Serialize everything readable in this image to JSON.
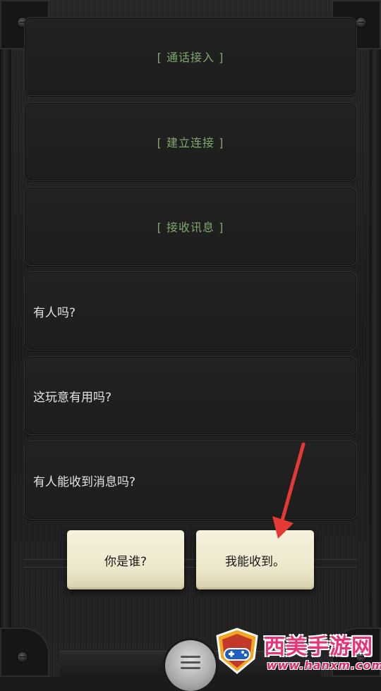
{
  "system_messages": [
    "[ 通话接入 ]",
    "[ 建立连接 ]",
    "[ 接收讯息 ]"
  ],
  "chat_messages": [
    "有人吗?",
    "这玩意有用吗?",
    "有人能收到消息吗?"
  ],
  "choices": {
    "option_a": "你是谁?",
    "option_b": "我能收到。"
  },
  "watermark": {
    "title": "西美手游网",
    "url": "www.hanxm.com"
  },
  "colors": {
    "system_text": "#7fa86e",
    "message_text": "#dfe3e6",
    "choice_bg": "#efe9cf",
    "arrow": "#e53935"
  },
  "icons": [
    "menu-icon",
    "pointer-arrow-icon",
    "gamepad-shield-logo"
  ]
}
